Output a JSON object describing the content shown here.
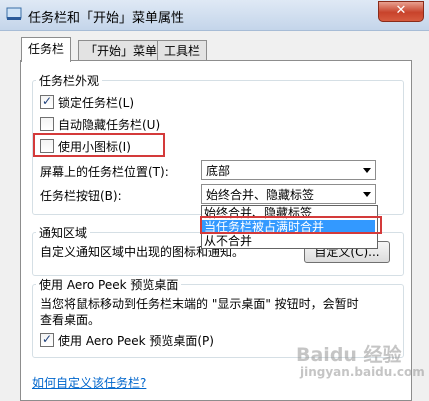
{
  "window": {
    "title": "任务栏和「开始」菜单属性",
    "close_label": "✕"
  },
  "tabs": [
    {
      "label": "任务栏"
    },
    {
      "label": "「开始」菜单"
    },
    {
      "label": "工具栏"
    }
  ],
  "appearance": {
    "group_label": "任务栏外观",
    "lock_taskbar": "锁定任务栏(L)",
    "auto_hide": "自动隐藏任务栏(U)",
    "small_icons": "使用小图标(I)",
    "position_label": "屏幕上的任务栏位置(T):",
    "position_value": "底部",
    "buttons_label": "任务栏按钮(B):",
    "buttons_value": "始终合并、隐藏标签",
    "buttons_options": [
      "始终合并、隐藏标签",
      "当任务栏被占满时合并",
      "从不合并"
    ]
  },
  "notification": {
    "group_label": "通知区域",
    "description": "自定义通知区域中出现的图标和通知。",
    "customize_button": "自定义(C)..."
  },
  "aero_peek": {
    "group_label": "使用 Aero Peek 预览桌面",
    "description_line1": "当您将鼠标移动到任务栏末端的 \"显示桌面\" 按钮时，会暂时",
    "description_line2": "查看桌面。",
    "checkbox_label": "使用 Aero Peek 预览桌面(P)"
  },
  "help_link": "如何自定义该任务栏?",
  "watermark": {
    "line1": "Baidu 经验",
    "line2": "jingyan.baidu.com"
  },
  "colors": {
    "highlight": "#3399ff",
    "annotation": "#d43a3a",
    "link": "#0066cc"
  }
}
